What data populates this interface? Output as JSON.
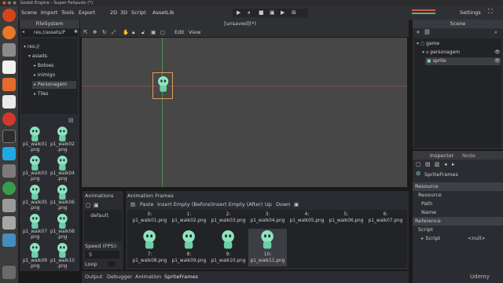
{
  "window": {
    "title": "Godot Engine - Super Felipudo (*)"
  },
  "menu": {
    "scene": "Scene",
    "import": "Import",
    "tools": "Tools",
    "export": "Export",
    "mode_2d": "2D",
    "mode_3d": "3D",
    "script": "Script",
    "assetlib": "AssetLib",
    "settings": "Settings"
  },
  "filesystem": {
    "tab": "FileSystem",
    "path": "res://assets/P",
    "tree": [
      "res://",
      "assets",
      "Botoes",
      "Inimigo",
      "Personagem",
      "Tiles"
    ],
    "files": [
      "p1_walk01",
      "p1_walk02",
      "p1_walk03",
      "p1_walk04",
      "p1_walk05",
      "p1_walk06",
      "p1_walk07",
      "p1_walk08",
      "p1_walk09",
      "p1_walk10"
    ],
    "ext": ".png"
  },
  "editor": {
    "edit": "Edit",
    "view": "View",
    "tab": "[unsaved](*)"
  },
  "scene_panel": {
    "title": "Scene",
    "nodes": [
      "game",
      "personagem",
      "sprite"
    ]
  },
  "inspector": {
    "tab_inspector": "Inspector",
    "tab_node": "Node",
    "resource_type": "SpriteFrames",
    "rows": {
      "resource_section": "Resource",
      "resource_sub": "Resource",
      "path": "Path",
      "name": "Name",
      "reference_section": "Reference",
      "script_section": "Script",
      "script": "Script",
      "script_value": "<null>"
    }
  },
  "animations": {
    "title": "Animations",
    "frames_title": "Animation Frames",
    "list": [
      "default"
    ],
    "speed_label": "Speed (FPS):",
    "speed_value": "5",
    "loop_label": "Loop",
    "toolbar": {
      "paste": "Paste",
      "insert_before": "Insert Empty (Before)",
      "insert_after": "Insert Empty (After)",
      "up": "Up",
      "down": "Down"
    },
    "frames_row1": [
      "0: p1_walk01.png",
      "1: p1_walk02.png",
      "2: p1_walk03.png",
      "3: p1_walk04.png",
      "4: p1_walk05.png",
      "5: p1_walk06.png",
      "6: p1_walk07.png"
    ],
    "frames_row2": [
      "7: p1_walk08.png",
      "8: p1_walk09.png",
      "9: p1_walk10.png",
      "10: p1_walk11.png"
    ]
  },
  "bottom_tabs": [
    "Output",
    "Debugger",
    "Animation",
    "SpriteFrames"
  ],
  "watermark": "Udemy",
  "colors": {
    "viewport": "#474747",
    "sprite": "#8de3c0",
    "accent": "#6fb5e8"
  }
}
